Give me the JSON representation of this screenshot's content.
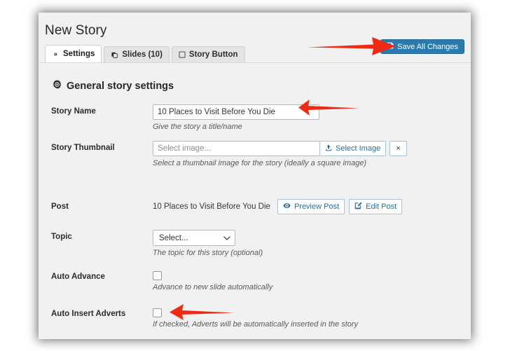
{
  "page": {
    "title": "New Story"
  },
  "tabs": [
    {
      "label": "Settings",
      "icon": "gear-icon",
      "active": true
    },
    {
      "label": "Slides (10)",
      "icon": "slides-icon",
      "active": false
    },
    {
      "label": "Story Button",
      "icon": "checkbox-icon",
      "active": false
    }
  ],
  "toolbar": {
    "save_label": "Save All Changes",
    "save_icon": "floppy-save-icon",
    "save_color": "#2a7ab0"
  },
  "section": {
    "heading": "General story settings",
    "heading_icon": "gear-icon"
  },
  "fields": {
    "story_name": {
      "label": "Story Name",
      "value": "10 Places to Visit Before You Die",
      "placeholder": "",
      "help": "Give the story a title/name"
    },
    "story_thumbnail": {
      "label": "Story Thumbnail",
      "value": "",
      "placeholder": "Select image...",
      "select_button": "Select Image",
      "select_button_icon": "upload-icon",
      "clear_button": "×",
      "help": "Select a thumbnail image for the story (ideally a square image)"
    },
    "post": {
      "label": "Post",
      "value": "10 Places to Visit Before You Die",
      "preview_button": "Preview Post",
      "preview_icon": "eye-icon",
      "edit_button": "Edit Post",
      "edit_icon": "pencil-square-icon"
    },
    "topic": {
      "label": "Topic",
      "value": "Select...",
      "options": [
        "Select..."
      ],
      "help": "The topic for this story (optional)"
    },
    "auto_advance": {
      "label": "Auto Advance",
      "checked": false,
      "help": "Advance to new slide automatically"
    },
    "auto_insert_adverts": {
      "label": "Auto Insert Adverts",
      "checked": false,
      "help": "If checked, Adverts will be automatically inserted in the story"
    }
  },
  "annotations": {
    "arrow_color": "#ee2a14",
    "arrows": [
      {
        "name": "arrow-to-save-button",
        "direction": "right"
      },
      {
        "name": "arrow-to-story-name",
        "direction": "left"
      },
      {
        "name": "arrow-to-auto-insert-adverts",
        "direction": "left"
      }
    ]
  }
}
